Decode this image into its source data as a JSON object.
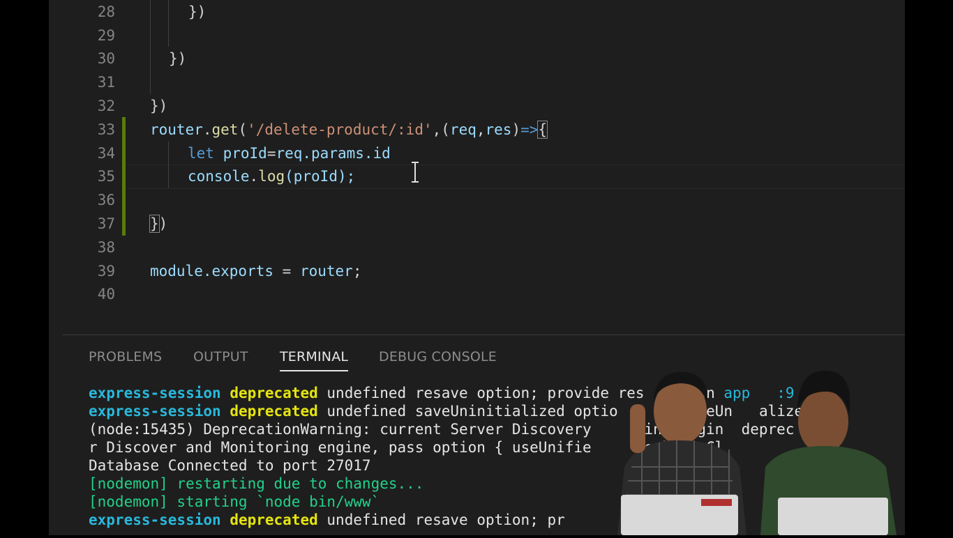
{
  "editor": {
    "lines": [
      {
        "num": "28"
      },
      {
        "num": "29"
      },
      {
        "num": "30"
      },
      {
        "num": "31"
      },
      {
        "num": "32"
      },
      {
        "num": "33"
      },
      {
        "num": "34"
      },
      {
        "num": "35"
      },
      {
        "num": "36"
      },
      {
        "num": "37"
      },
      {
        "num": "38"
      },
      {
        "num": "39"
      },
      {
        "num": "40"
      }
    ],
    "code": {
      "l28": "})",
      "l30": "})",
      "l32": "})",
      "l33_router": "router",
      "l33_dot": ".",
      "l33_get": "get",
      "l33_open": "(",
      "l33_str": "'/delete-product/:id'",
      "l33_comma": ",(",
      "l33_req": "req",
      "l33_c2": ",",
      "l33_res": "res",
      "l33_close": ")",
      "l33_arrow": "=>",
      "l33_brace": "{",
      "l34_let": "let",
      "l34_var": "proId",
      "l34_eq": "=",
      "l34_rhs": "req.params.id",
      "l35_console": "console",
      "l35_dot": ".",
      "l35_log": "log",
      "l35_args": "(proId);",
      "l37_brace": "}",
      "l37_paren": ")",
      "l39_module": "module.exports",
      "l39_eq": " = ",
      "l39_router": "router",
      "l39_semi": ";"
    }
  },
  "panel": {
    "tabs": [
      {
        "label": "PROBLEMS"
      },
      {
        "label": "OUTPUT"
      },
      {
        "label": "TERMINAL"
      },
      {
        "label": "DEBUG CONSOLE"
      }
    ],
    "active_tab": "TERMINAL"
  },
  "terminal": {
    "l1_a": "express-session",
    "l1_b": "deprecated",
    "l1_c": "undefined resave option; provide res",
    "l1_d": "ption",
    "l1_e": "app",
    "l1_f": ":9",
    "l2_a": "express-session",
    "l2_b": "deprecated",
    "l2_c": "undefined saveUninitialized optio",
    "l2_d": "de saveUn",
    "l2_e": "alized",
    "l3": "(node:15435) DeprecationWarning: current Server Discovery",
    "l3_b": "ring engin",
    "l3_c": "deprec",
    "l4": "r Discover and Monitoring engine, pass option { useUnifie",
    "l4_b": "e }",
    "l4_c": "oCl",
    "l5": "Database Connected to port 27017",
    "l6": "[nodemon] restarting due to changes...",
    "l7": "[nodemon] starting `node bin/www`",
    "l8_a": "express-session",
    "l8_b": "deprecated",
    "l8_c": "undefined resave option; pr"
  },
  "colors": {
    "editor_bg": "#1e1e1e",
    "git_modified": "#587c0c",
    "string": "#ce9178",
    "function": "#dcdcaa",
    "variable": "#9cdcfe",
    "keyword": "#569cd6"
  },
  "icons": {
    "cursor": "text-cursor-icon"
  }
}
